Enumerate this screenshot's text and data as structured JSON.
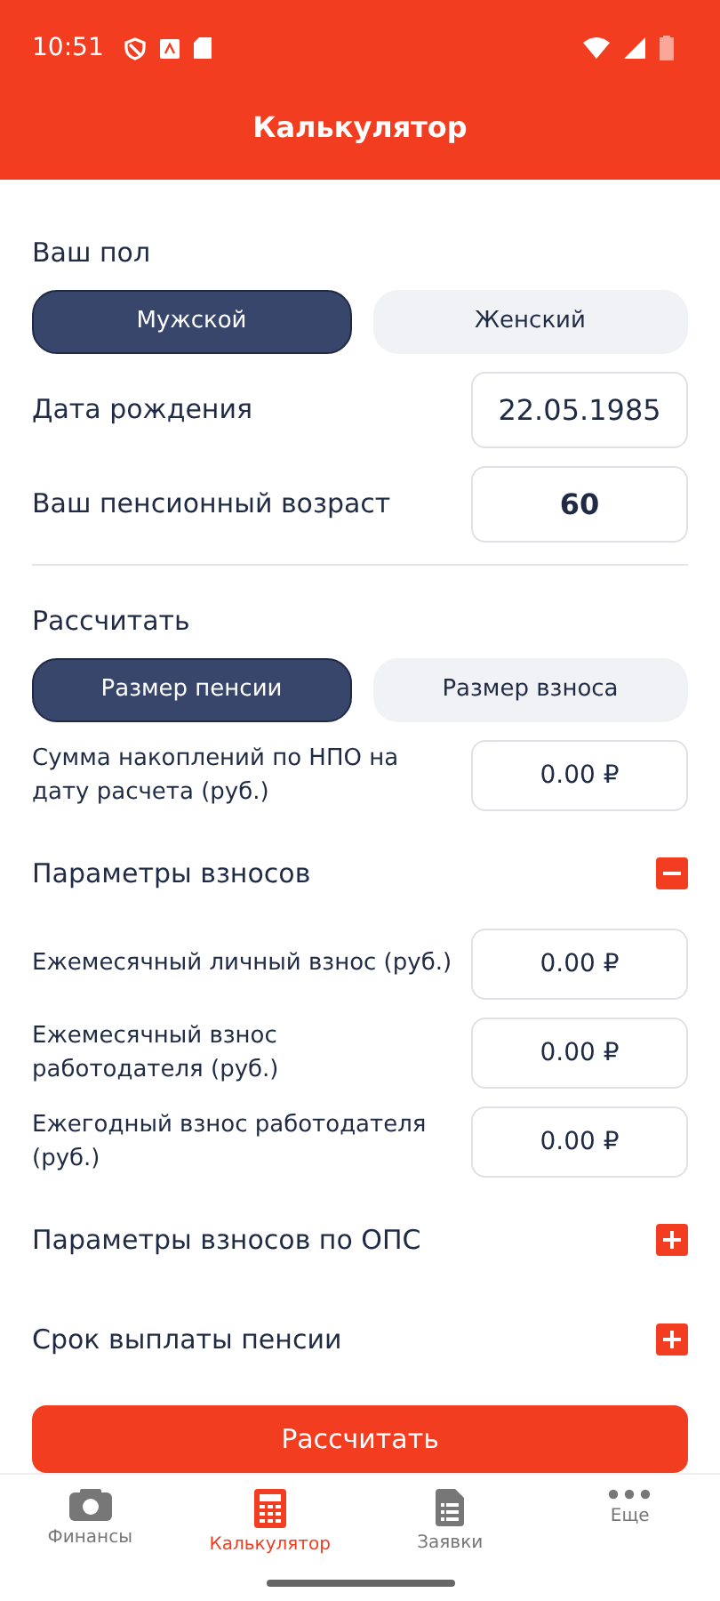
{
  "status_bar": {
    "time": "10:51"
  },
  "header": {
    "title": "Калькулятор"
  },
  "gender": {
    "label": "Ваш пол",
    "options": [
      {
        "label": "Мужской",
        "selected": true
      },
      {
        "label": "Женский",
        "selected": false
      }
    ]
  },
  "birth_date": {
    "label": "Дата рождения",
    "value": "22.05.1985"
  },
  "retirement_age": {
    "label": "Ваш пенсионный возраст",
    "value": "60"
  },
  "calculate_mode": {
    "label": "Рассчитать",
    "options": [
      {
        "label": "Размер пенсии",
        "selected": true
      },
      {
        "label": "Размер взноса",
        "selected": false
      }
    ]
  },
  "savings": {
    "label": "Сумма накоплений по НПО на дату расчета (руб.)",
    "value": "0.00 ₽"
  },
  "sections": [
    {
      "title": "Параметры взносов",
      "expanded": true,
      "fields": [
        {
          "label": "Ежемесячный личный взнос (руб.)",
          "value": "0.00 ₽"
        },
        {
          "label": "Ежемесячный взнос работодателя (руб.)",
          "value": "0.00 ₽"
        },
        {
          "label": "Ежегодный взнос работодателя (руб.)",
          "value": "0.00 ₽"
        }
      ]
    },
    {
      "title": "Параметры взносов по ОПС",
      "expanded": false
    },
    {
      "title": "Срок выплаты пенсии",
      "expanded": false
    }
  ],
  "submit_button": "Рассчитать",
  "bottom_nav": [
    {
      "label": "Финансы",
      "selected": false
    },
    {
      "label": "Калькулятор",
      "selected": true
    },
    {
      "label": "Заявки",
      "selected": false
    },
    {
      "label": "Еще",
      "selected": false
    }
  ]
}
